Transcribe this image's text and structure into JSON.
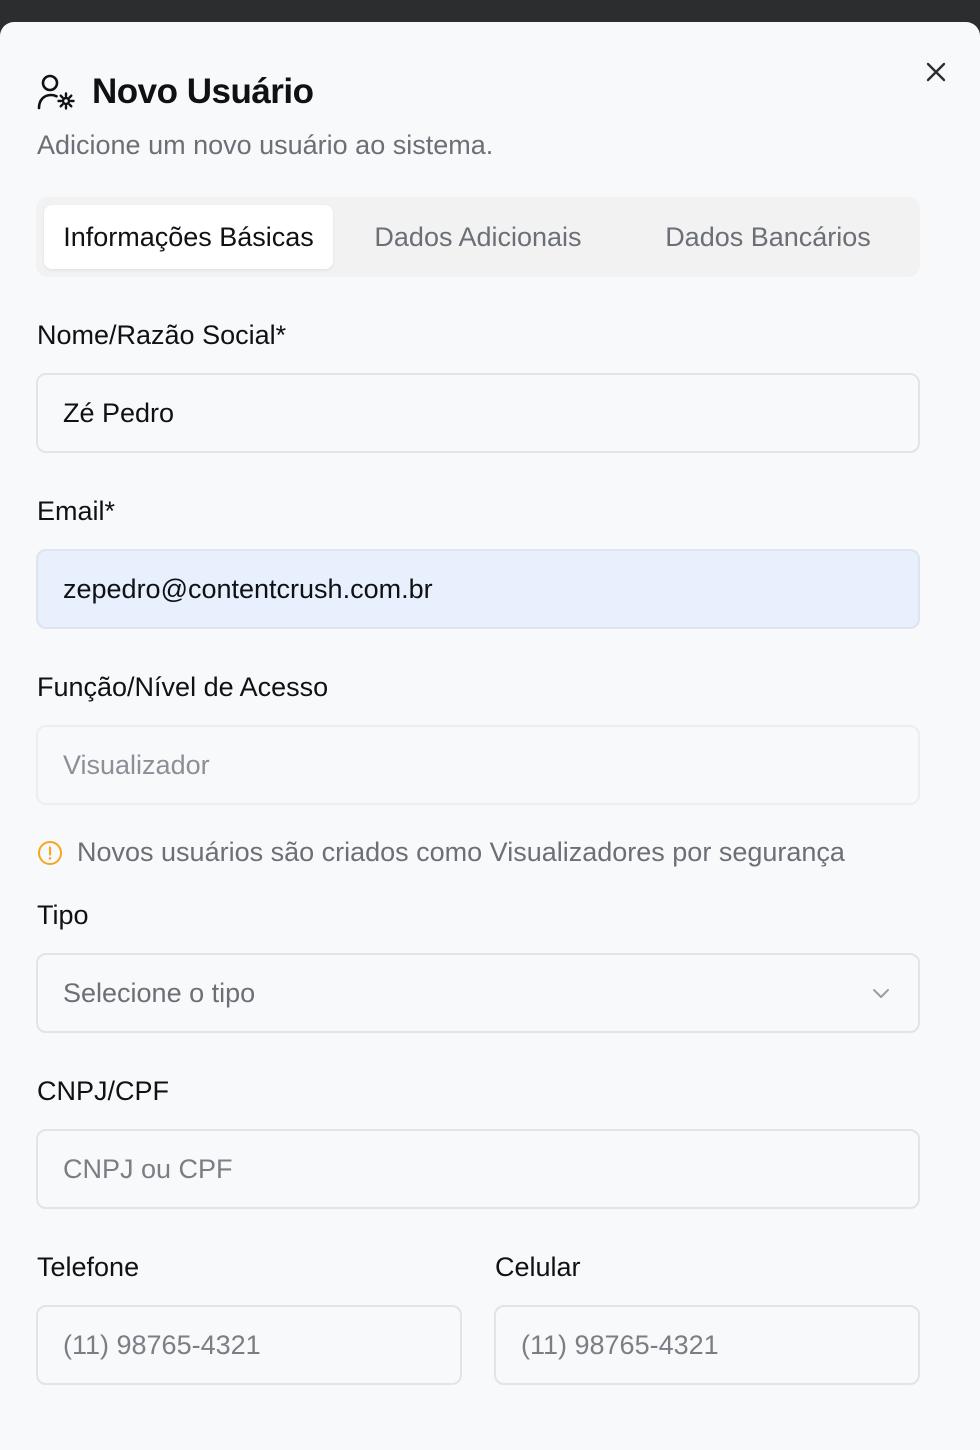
{
  "dialog": {
    "title": "Novo Usuário",
    "subtitle": "Adicione um novo usuário ao sistema.",
    "icons": {
      "title": "user-cog-icon",
      "close": "close-icon"
    }
  },
  "tabs": [
    {
      "label": "Informações Básicas",
      "active": true
    },
    {
      "label": "Dados Adicionais",
      "active": false
    },
    {
      "label": "Dados Bancários",
      "active": false
    }
  ],
  "form": {
    "name": {
      "label": "Nome/Razão Social*",
      "value": "Zé Pedro"
    },
    "email": {
      "label": "Email*",
      "value": "zepedro@contentcrush.com.br"
    },
    "role": {
      "label": "Função/Nível de Acesso",
      "value": "Visualizador",
      "hint": "Novos usuários são criados como Visualizadores por segurança",
      "hint_icon": "alert-circle-icon",
      "hint_color": "#f5a623"
    },
    "type": {
      "label": "Tipo",
      "placeholder": "Selecione o tipo"
    },
    "document": {
      "label": "CNPJ/CPF",
      "placeholder": "CNPJ ou CPF"
    },
    "phone": {
      "label": "Telefone",
      "placeholder": "(11) 98765-4321"
    },
    "mobile": {
      "label": "Celular",
      "placeholder": "(11) 98765-4321"
    }
  }
}
